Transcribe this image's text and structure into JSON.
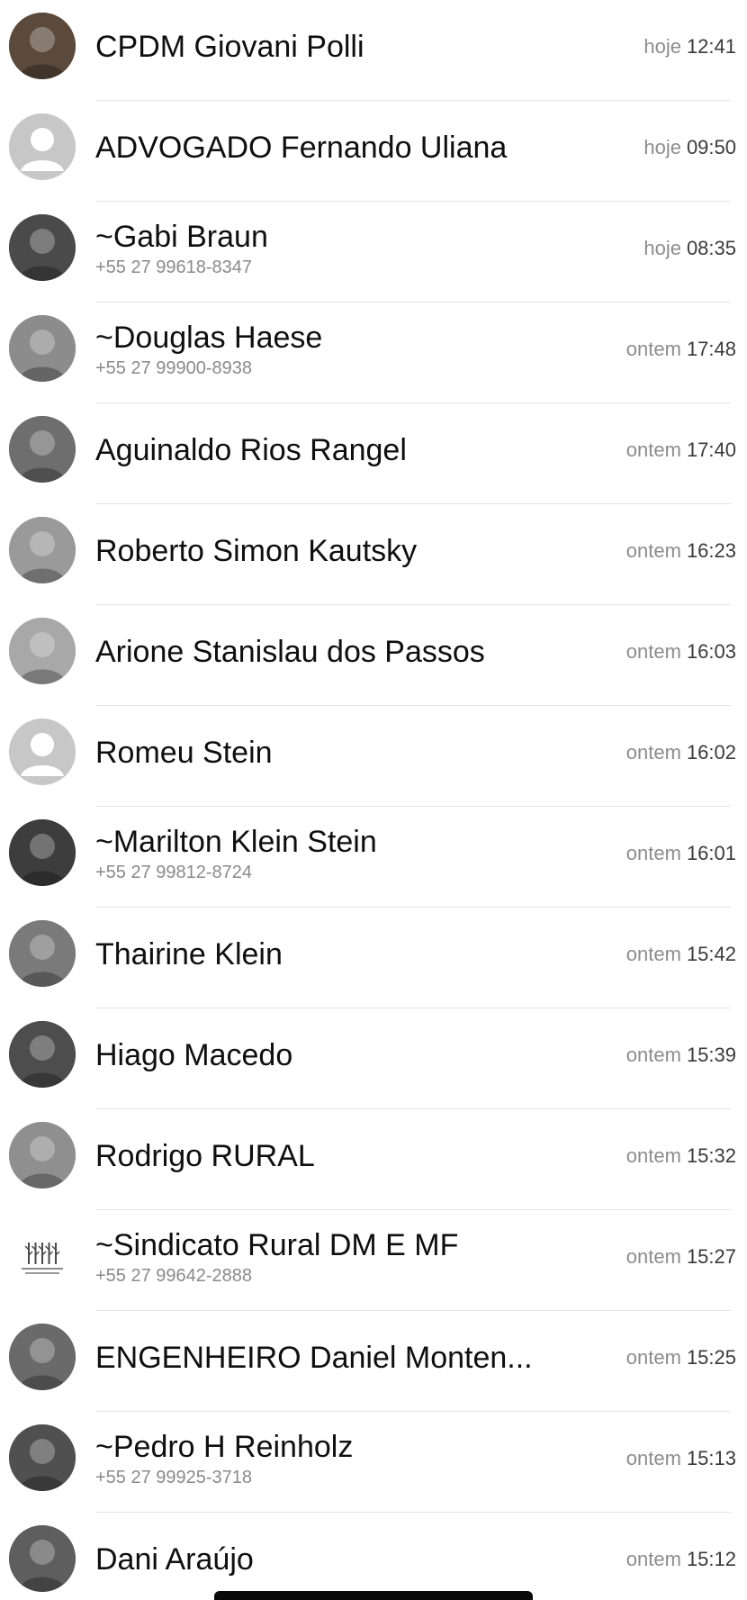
{
  "chats": [
    {
      "name": "CPDM Giovani Polli",
      "phone": "",
      "day": "hoje",
      "time": "12:41",
      "avatar": "photo-avatar",
      "color": "#5b4a3c"
    },
    {
      "name": "ADVOGADO Fernando Uliana",
      "phone": "",
      "day": "hoje",
      "time": "09:50",
      "avatar": "default-avatar",
      "color": "#b9b9b9"
    },
    {
      "name": "~Gabi Braun",
      "phone": "+55 27 99618-8347",
      "day": "hoje",
      "time": "08:35",
      "avatar": "photo-avatar",
      "color": "#4a4a4a"
    },
    {
      "name": "~Douglas Haese",
      "phone": "+55 27 99900-8938",
      "day": "ontem",
      "time": "17:48",
      "avatar": "photo-avatar",
      "color": "#8c8c8c"
    },
    {
      "name": "Aguinaldo Rios Rangel",
      "phone": "",
      "day": "ontem",
      "time": "17:40",
      "avatar": "photo-avatar",
      "color": "#6e6e6e"
    },
    {
      "name": "Roberto Simon Kautsky",
      "phone": "",
      "day": "ontem",
      "time": "16:23",
      "avatar": "photo-avatar",
      "color": "#9a9a9a"
    },
    {
      "name": "Arione Stanislau dos Passos",
      "phone": "",
      "day": "ontem",
      "time": "16:03",
      "avatar": "photo-avatar",
      "color": "#a8a8a8"
    },
    {
      "name": "Romeu Stein",
      "phone": "",
      "day": "ontem",
      "time": "16:02",
      "avatar": "default-avatar",
      "color": "#b9b9b9"
    },
    {
      "name": "~Marilton Klein Stein",
      "phone": "+55 27 99812-8724",
      "day": "ontem",
      "time": "16:01",
      "avatar": "photo-avatar",
      "color": "#3d3d3d"
    },
    {
      "name": "Thairine Klein",
      "phone": "",
      "day": "ontem",
      "time": "15:42",
      "avatar": "photo-avatar",
      "color": "#7a7a7a"
    },
    {
      "name": "Hiago Macedo",
      "phone": "",
      "day": "ontem",
      "time": "15:39",
      "avatar": "photo-avatar",
      "color": "#4d4d4d"
    },
    {
      "name": "Rodrigo RURAL",
      "phone": "",
      "day": "ontem",
      "time": "15:32",
      "avatar": "photo-avatar",
      "color": "#8f8f8f"
    },
    {
      "name": "~Sindicato Rural DM E MF",
      "phone": "+55 27 99642-2888",
      "day": "ontem",
      "time": "15:27",
      "avatar": "logo-avatar",
      "color": "#ffffff"
    },
    {
      "name": "ENGENHEIRO Daniel Monten...",
      "phone": "",
      "day": "ontem",
      "time": "15:25",
      "avatar": "photo-avatar",
      "color": "#6a6a6a"
    },
    {
      "name": "~Pedro H Reinholz",
      "phone": "+55 27 99925-3718",
      "day": "ontem",
      "time": "15:13",
      "avatar": "photo-avatar",
      "color": "#505050"
    },
    {
      "name": "Dani Araújo",
      "phone": "",
      "day": "ontem",
      "time": "15:12",
      "avatar": "photo-avatar",
      "color": "#5e5e5e"
    }
  ]
}
